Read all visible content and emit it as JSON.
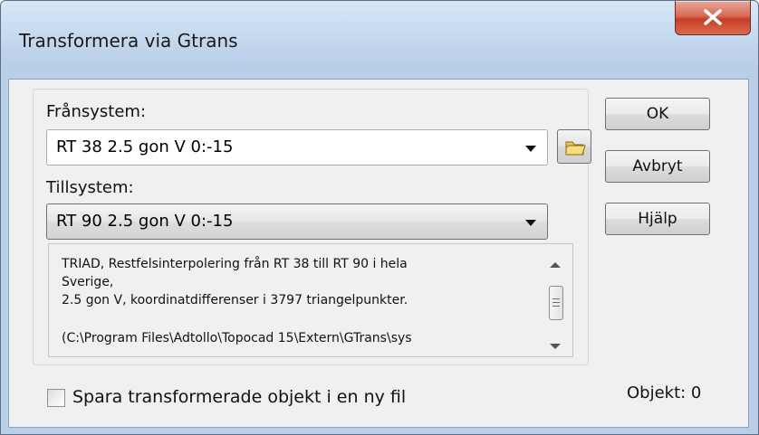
{
  "window": {
    "title": "Transformera via Gtrans"
  },
  "from_system": {
    "label": "Frånsystem:",
    "value": "RT 38 2.5 gon V 0:-15"
  },
  "to_system": {
    "label": "Tillsystem:",
    "value": "RT 90 2.5 gon V 0:-15"
  },
  "description": {
    "lines": [
      "TRIAD, Restfelsinterpolering från RT 38 till RT 90 i hela",
      "Sverige,",
      "2.5 gon V, koordinatdifferenser i 3797 triangelpunkter.",
      "",
      "(C:\\Program Files\\Adtollo\\Topocad 15\\Extern\\GTrans\\sys"
    ]
  },
  "buttons": {
    "ok": "OK",
    "cancel": "Avbryt",
    "help": "Hjälp"
  },
  "save_checkbox": {
    "label": "Spara transformerade objekt i en ny fil",
    "checked": false
  },
  "object_count": "Objekt: 0",
  "icons": {
    "close": "close-icon",
    "folder": "folder-icon"
  }
}
